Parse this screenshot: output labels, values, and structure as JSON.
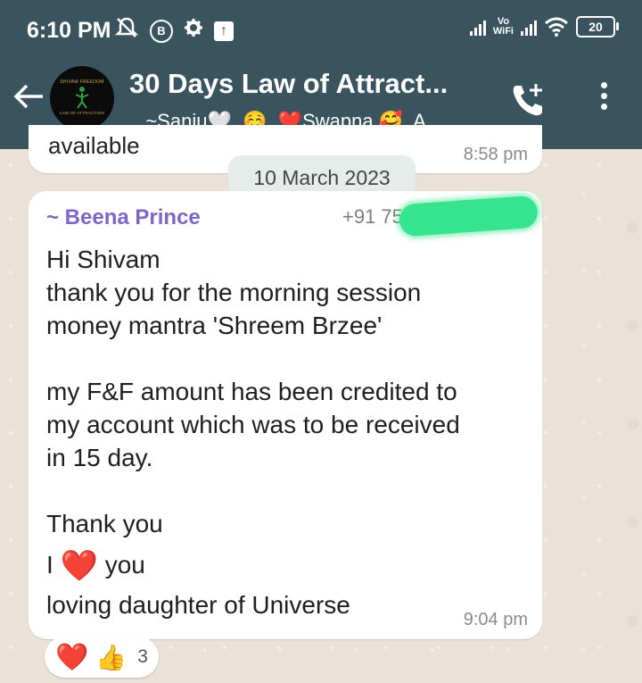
{
  "status_bar": {
    "time": "6:10 PM",
    "icons_left": [
      "mute-notification-icon",
      "b-badge-icon",
      "gear-icon",
      "upload-icon"
    ],
    "network": [
      "signal-icon",
      "vowifi-icon",
      "signal-icon",
      "wifi-icon"
    ],
    "vowifi_line1": "Vo",
    "vowifi_line2": "WiFi",
    "battery": "20"
  },
  "header": {
    "title": "30 Days Law of Attract...",
    "subtitle": "., ~Sanju🤍, ☺️, ❤️Swapna 🥰, A...",
    "avatar_text_top": "SHIVAM FREEDOM",
    "avatar_text_bottom": "LAW OF ATTRACTION",
    "background_color": "#39545F"
  },
  "previous_message": {
    "text_fragment": "available",
    "time": "8:58 pm"
  },
  "date_separator": "10 March 2023",
  "message": {
    "sender": "~ Beena Prince",
    "phone": "+91 75",
    "sender_color": "#7B67C8",
    "lines": [
      "Hi Shivam",
      "thank you for the morning session",
      "money mantra 'Shreem Brzee'",
      "",
      "my F&F amount has been credited to",
      "my account which was to be received",
      "in 15 day.",
      "",
      "Thank you"
    ],
    "love_line_prefix": "I",
    "love_line_emoji": "❤️",
    "love_line_suffix": "you",
    "last_line": "loving daughter of Universe",
    "time": "9:04 pm"
  },
  "reactions": {
    "emojis": [
      "❤️",
      "👍"
    ],
    "count": "3"
  }
}
